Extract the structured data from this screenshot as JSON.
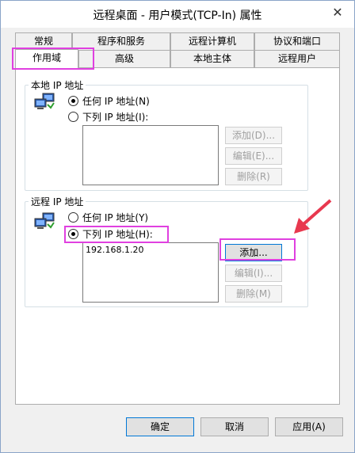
{
  "window": {
    "title": "远程桌面 - 用户模式(TCP-In) 属性",
    "close_glyph": "✕"
  },
  "tabs_row1": [
    "常规",
    "程序和服务",
    "远程计算机",
    "协议和端口"
  ],
  "tabs_row2": [
    "作用域",
    "高级",
    "本地主体",
    "远程用户"
  ],
  "local": {
    "label": "本地 IP 地址",
    "option_any": "任何 IP 地址(N)",
    "option_list": "下列 IP 地址(I):",
    "add": "添加(D)...",
    "edit": "编辑(E)...",
    "remove": "删除(R)"
  },
  "remote": {
    "label": "远程 IP 地址",
    "option_any": "任何 IP 地址(Y)",
    "option_list": "下列 IP 地址(H):",
    "list_items": [
      "192.168.1.20"
    ],
    "add": "添加...",
    "edit": "编辑(I)...",
    "remove": "删除(M)"
  },
  "footer": {
    "ok": "确定",
    "cancel": "取消",
    "apply": "应用(A)"
  },
  "colors": {
    "highlight": "#e040e0",
    "arrow": "#e8384f"
  }
}
